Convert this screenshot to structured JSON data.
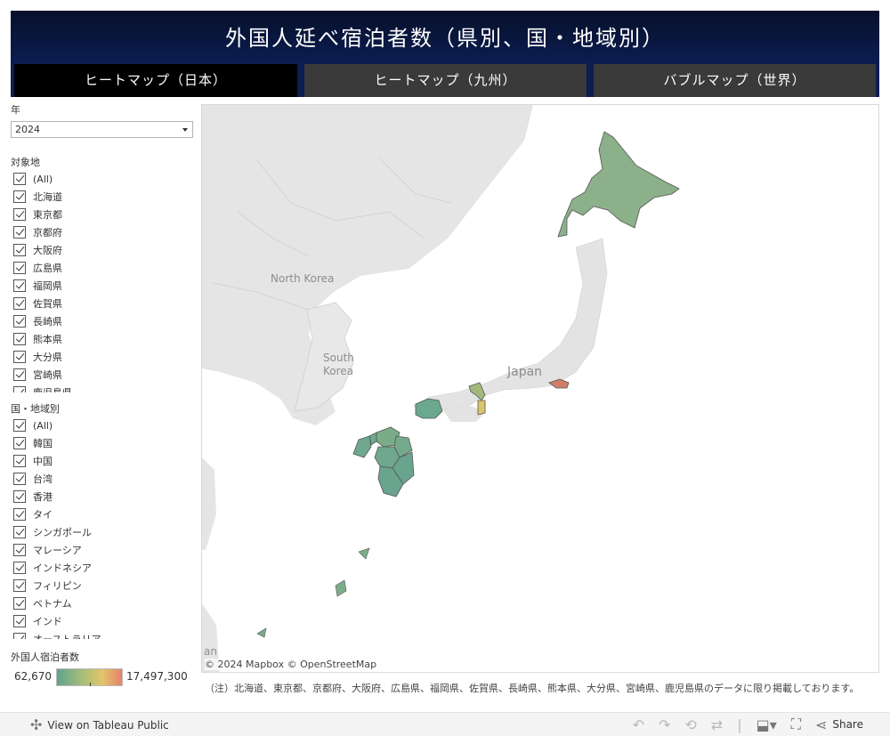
{
  "header": {
    "title": "外国人延べ宿泊者数（県別、国・地域別）"
  },
  "tabs": [
    "ヒートマップ（日本）",
    "ヒートマップ（九州）",
    "バブルマップ（世界）"
  ],
  "filters": {
    "year": {
      "label": "年",
      "value": "2024"
    },
    "target": {
      "label": "対象地",
      "items": [
        "(All)",
        "北海道",
        "東京都",
        "京都府",
        "大阪府",
        "広島県",
        "福岡県",
        "佐賀県",
        "長崎県",
        "熊本県",
        "大分県",
        "宮崎県",
        "鹿児島県"
      ]
    },
    "country": {
      "label": "国・地域別",
      "items": [
        "(All)",
        "韓国",
        "中国",
        "台湾",
        "香港",
        "タイ",
        "シンガポール",
        "マレーシア",
        "インドネシア",
        "フィリピン",
        "ベトナム",
        "インド",
        "オーストラリア"
      ]
    }
  },
  "legend": {
    "title": "外国人宿泊者数",
    "min": "62,670",
    "max": "17,497,300"
  },
  "map": {
    "labels": {
      "north_korea": "North Korea",
      "south_korea_1": "South",
      "south_korea_2": "Korea",
      "japan": "Japan",
      "edge": "an"
    },
    "attribution": "© 2024 Mapbox  © OpenStreetMap"
  },
  "note": "（注）北海道、東京都、京都府、大阪府、広島県、福岡県、佐賀県、長崎県、熊本県、大分県、宮崎県、鹿児島県のデータに限り掲載しております。",
  "toolbar": {
    "view_label": "View on Tableau Public",
    "share_label": "Share"
  }
}
